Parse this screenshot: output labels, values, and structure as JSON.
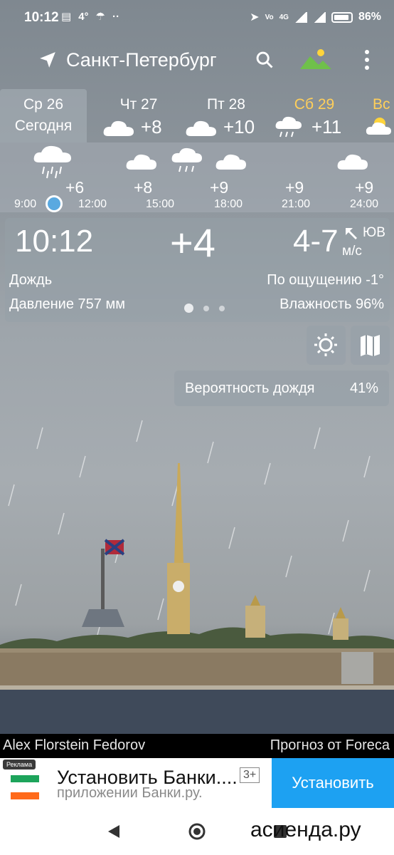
{
  "status": {
    "time": "10:12",
    "temp": "4°",
    "battery": "86%",
    "net": "4G"
  },
  "app": {
    "city": "Санкт-Петербург"
  },
  "days": [
    {
      "name": "Ср 26",
      "sub": "Сегодня",
      "temp": ""
    },
    {
      "name": "Чт 27",
      "sub": "",
      "temp": "+8"
    },
    {
      "name": "Пт 28",
      "sub": "",
      "temp": "+10"
    },
    {
      "name": "Сб 29",
      "sub": "",
      "temp": "+11"
    },
    {
      "name": "Вс",
      "sub": "",
      "temp": ""
    }
  ],
  "hourly": {
    "temps": [
      "+6",
      "+8",
      "+9",
      "+9",
      "+9"
    ],
    "times": [
      "9:00",
      "12:00",
      "15:00",
      "18:00",
      "21:00",
      "24:00"
    ]
  },
  "current": {
    "time": "10:12",
    "temp": "+4",
    "wind_speed": "4-7",
    "wind_dir": "ЮВ",
    "wind_unit": "м/с",
    "description": "Дождь",
    "feels_like": "По ощущению -1°",
    "pressure": "Давление 757 мм",
    "humidity": "Влажность 96%"
  },
  "rain": {
    "label": "Вероятность дождя",
    "percent": "41%"
  },
  "credits": {
    "photo": "Alex Florstein Fedorov",
    "source": "Прогноз от Foreca"
  },
  "ad": {
    "tag": "Реклама",
    "title": "Установить Банки....",
    "subtitle": "приложении Банки.ру.",
    "age": "3+",
    "button": "Установить"
  },
  "watermark": "асиенда.ру"
}
